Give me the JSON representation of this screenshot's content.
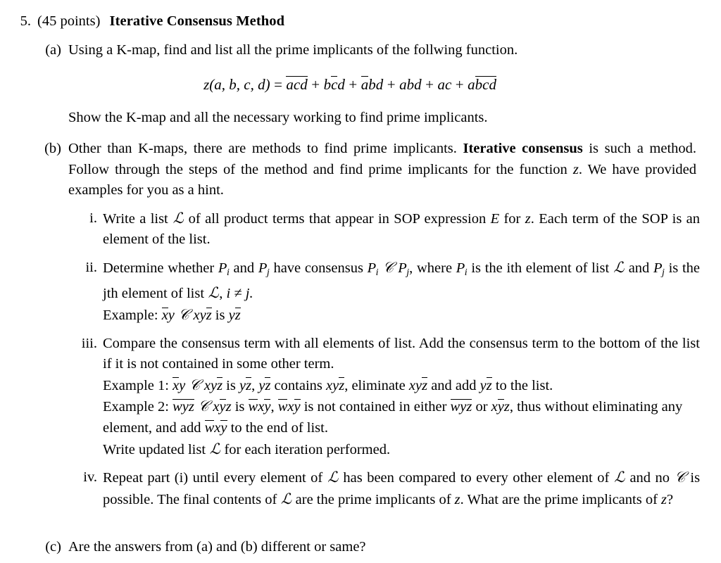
{
  "document": {
    "problem_number": "5.",
    "points": "(45 points)",
    "title": "Iterative Consensus Method"
  },
  "parts": {
    "a": {
      "marker": "(a)",
      "text": "Using a K-map, find and list all the prime implicants of the follwing function.",
      "equation": {
        "lhs_fn": "z",
        "lhs_args": "(a, b, c, d)",
        "equals": "=",
        "terms": [
          {
            "display": "āc̄d̄",
            "vars": [
              {
                "sym": "a",
                "bar": true
              },
              {
                "sym": "c",
                "bar": true
              },
              {
                "sym": "d",
                "bar": true
              }
            ]
          },
          {
            "display": "bc̄d",
            "vars": [
              {
                "sym": "b",
                "bar": false
              },
              {
                "sym": "c",
                "bar": true
              },
              {
                "sym": "d",
                "bar": false
              }
            ]
          },
          {
            "display": "ābd",
            "vars": [
              {
                "sym": "a",
                "bar": true
              },
              {
                "sym": "b",
                "bar": false
              },
              {
                "sym": "d",
                "bar": false
              }
            ]
          },
          {
            "display": "abd",
            "vars": [
              {
                "sym": "a",
                "bar": false
              },
              {
                "sym": "b",
                "bar": false
              },
              {
                "sym": "d",
                "bar": false
              }
            ]
          },
          {
            "display": "ac",
            "vars": [
              {
                "sym": "a",
                "bar": false
              },
              {
                "sym": "c",
                "bar": false
              }
            ]
          },
          {
            "display": "ab̄c̄d̄",
            "vars": [
              {
                "sym": "a",
                "bar": false
              },
              {
                "sym": "b",
                "bar": true
              },
              {
                "sym": "c",
                "bar": true
              },
              {
                "sym": "d",
                "bar": true
              }
            ]
          }
        ],
        "plus": "+",
        "full_text": "z(a, b, c, d) = āc̄d̄ + bc̄d + ābd + abd + ac + ab̄c̄d̄"
      },
      "followup": "Show the K-map and all the necessary working to find prime implicants."
    },
    "b": {
      "marker": "(b)",
      "text_before_bold": "Other than K-maps, there are methods to find prime implicants.",
      "bold_phrase": "Iterative consensus",
      "text_after_bold": "is such a method. Follow through the steps of the method and find prime implicants for the function",
      "var_z": "z",
      "text_tail": ". We have provided examples for you as a hint.",
      "subitems": {
        "i": {
          "marker": "i.",
          "p1": "Write a list",
          "script_L": "ℒ",
          "p2": "of all product terms that appear in SOP expression",
          "var_E": "E",
          "p3": "for",
          "var_z": "z",
          "p4": ". Each term of the SOP is an element of the list."
        },
        "ii": {
          "marker": "ii.",
          "p1": "Determine whether",
          "P_i": "P",
          "sub_i": "i",
          "p2": "and",
          "P_j": "P",
          "sub_j": "j",
          "p3": "have consensus",
          "script_C": "𝒞",
          "p4": ", where",
          "p5": "is the ith element of list",
          "script_L": "ℒ",
          "p6": "and",
          "p7": "is the jth element of list",
          "p8": ",",
          "neq": "i ≠ j.",
          "example_label": "Example:",
          "example": {
            "t1": "x̄y",
            "op": "𝒞",
            "t2": "xyz̄",
            "is": "is",
            "t3": "yz̄"
          }
        },
        "iii": {
          "marker": "iii.",
          "text": "Compare the consensus term with all elements of list. Add the consensus term to the bottom of the list if it is not contained in some other term.",
          "example1_label": "Example 1:",
          "example1": {
            "t1": "x̄y",
            "op": "𝒞",
            "t2": "xyz̄",
            "seg1": "is",
            "t3": "yz̄",
            "seg2": ",",
            "t4": "yz̄",
            "seg3": "contains",
            "t5": "xyz̄",
            "seg4": ", eliminate",
            "t6": "xyz̄",
            "seg5": "and add",
            "t7": "yz̄",
            "seg6": "to the list."
          },
          "example2_label": "Example 2:",
          "example2": {
            "t1": "w̄ȳz̄",
            "op": "𝒞",
            "t2": "xȳz",
            "seg1": "is",
            "t3": "w̄xȳ",
            "seg2": ",",
            "t4": "w̄xȳ",
            "seg3": "is not contained in either",
            "t5": "w̄ȳz̄",
            "seg4": "or",
            "t6": "xȳz",
            "seg5": ", thus without eliminating any element, and add",
            "t7": "w̄xȳ",
            "seg6": "to the end of list."
          },
          "write_updated_p1": "Write updated list",
          "write_updated_L": "ℒ",
          "write_updated_p2": "for each iteration performed."
        },
        "iv": {
          "marker": "iv.",
          "p1": "Repeat part (i) until every element of",
          "script_L": "ℒ",
          "p2": "has been compared to every other element of",
          "p3": "and no",
          "script_C": "𝒞",
          "p4": "is possible.  The final contents of",
          "p5": "are the prime implicants of",
          "var_z": "z",
          "p6": ". What are the prime implicants of",
          "p7": "?"
        }
      }
    },
    "c": {
      "marker": "(c)",
      "text": "Are the answers from (a) and (b) different or same?"
    }
  }
}
